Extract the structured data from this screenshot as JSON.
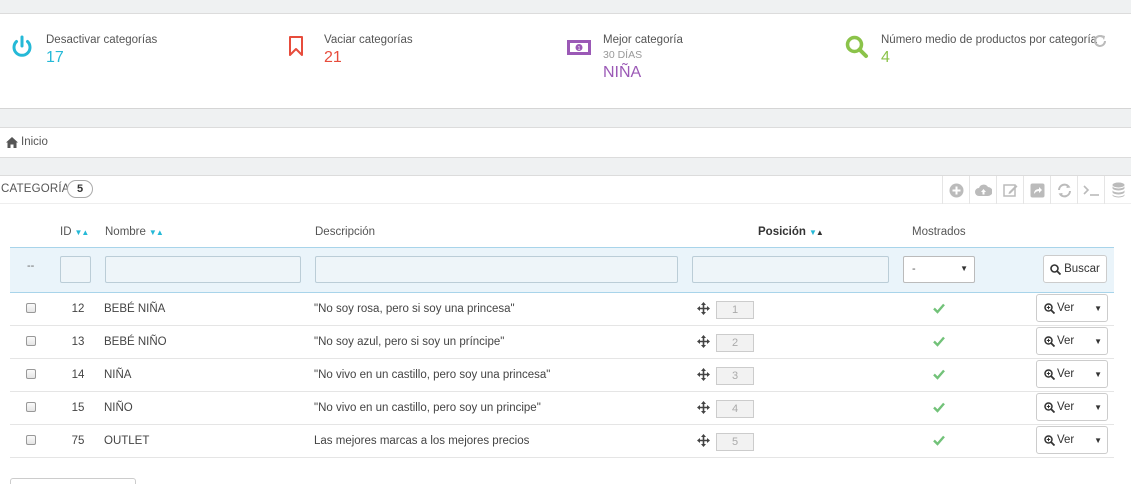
{
  "kpis": [
    {
      "label": "Desactivar categorías",
      "value": "17",
      "color": "#25b9d7",
      "icon": "power-icon"
    },
    {
      "label": "Vaciar categorías",
      "value": "21",
      "color": "#e74c3c",
      "icon": "bookmark-icon"
    },
    {
      "label": "Mejor categoría",
      "sub": "30 DÍAS",
      "value": "NIÑA",
      "color": "#9b59b6",
      "icon": "money-icon"
    },
    {
      "label": "Número medio de productos por categoría",
      "value": "4",
      "color": "#8bc34a",
      "icon": "search-icon"
    }
  ],
  "breadcrumb": {
    "home": "Inicio"
  },
  "panel": {
    "title": "Categorías",
    "count": "5"
  },
  "columns": {
    "id": "ID",
    "name": "Nombre",
    "description": "Descripción",
    "position": "Posición",
    "displayed": "Mostrados"
  },
  "filters": {
    "dash": "--",
    "displayed_option": "-",
    "search_label": "Buscar"
  },
  "rows": [
    {
      "id": "12",
      "name": "BEBÉ NIÑA",
      "description": "\"No soy rosa, pero si soy una princesa\"",
      "position": "1",
      "action": "Ver"
    },
    {
      "id": "13",
      "name": "BEBÉ NIÑO",
      "description": "\"No soy azul, pero si soy un príncipe\"",
      "position": "2",
      "action": "Ver"
    },
    {
      "id": "14",
      "name": "NIÑA",
      "description": "\"No vivo en un castillo, pero soy una princesa\"",
      "position": "3",
      "action": "Ver"
    },
    {
      "id": "15",
      "name": "NIÑO",
      "description": "\"No vivo en un castillo, pero soy un principe\"",
      "position": "4",
      "action": "Ver"
    },
    {
      "id": "75",
      "name": "OUTLET",
      "description": "Las mejores marcas a los mejores precios",
      "position": "5",
      "action": "Ver"
    }
  ],
  "colors": {
    "accent": "#25b9d7",
    "check": "#72c279"
  }
}
